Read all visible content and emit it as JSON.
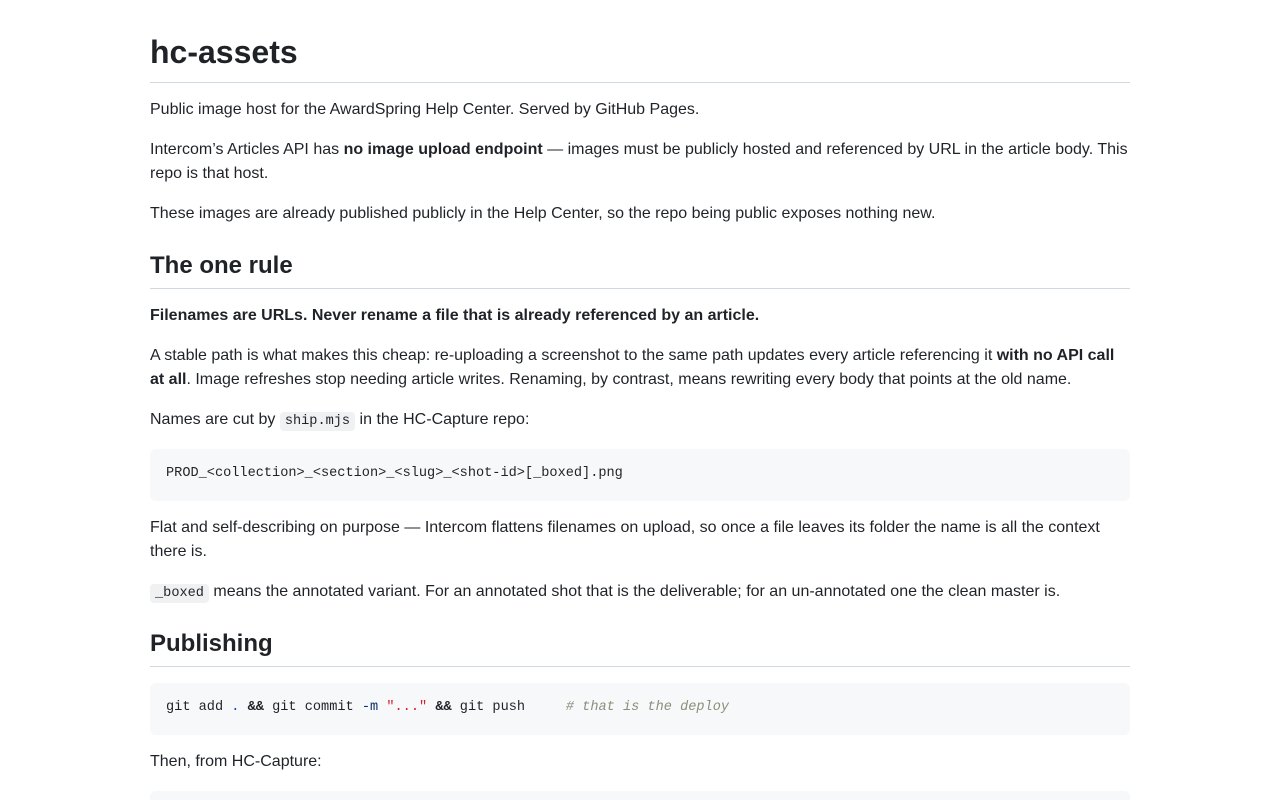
{
  "title": "hc-assets",
  "intro": {
    "p1": "Public image host for the AwardSpring Help Center. Served by GitHub Pages.",
    "p2_before": "Intercom’s Articles API has ",
    "p2_strong": "no image upload endpoint",
    "p2_after": " — images must be publicly hosted and referenced by URL in the article body. This repo is that host.",
    "p3": "These images are already published publicly in the Help Center, so the repo being public exposes nothing new."
  },
  "one_rule": {
    "heading": "The one rule",
    "rule_statement": "Filenames are URLs. Never rename a file that is already referenced by an article.",
    "p_before": "A stable path is what makes this cheap: re-uploading a screenshot to the same path updates every article referencing it ",
    "p_strong": "with no API call at all",
    "p_after": ". Image refreshes stop needing article writes. Renaming, by contrast, means rewriting every body that points at the old name.",
    "names_before": "Names are cut by ",
    "names_code": "ship.mjs",
    "names_after": " in the HC-Capture repo:",
    "pattern": "PROD_<collection>_<section>_<slug>_<shot-id>[_boxed].png",
    "flat": "Flat and self-describing on purpose — Intercom flattens filenames on upload, so once a file leaves its folder the name is all the context there is.",
    "boxed_code": "_boxed",
    "boxed_text": " means the annotated variant. For an annotated shot that is the deliverable; for an un-annotated one the clean master is."
  },
  "publishing": {
    "heading": "Publishing",
    "cmd": {
      "git1": "git add ",
      "dot": ".",
      "and1": "&&",
      "git2": " git commit ",
      "flag": "-m",
      "msg": "\"...\"",
      "and2": "&&",
      "git3": " git push",
      "comment": "# that is the deploy"
    },
    "then": "Then, from HC-Capture:"
  }
}
